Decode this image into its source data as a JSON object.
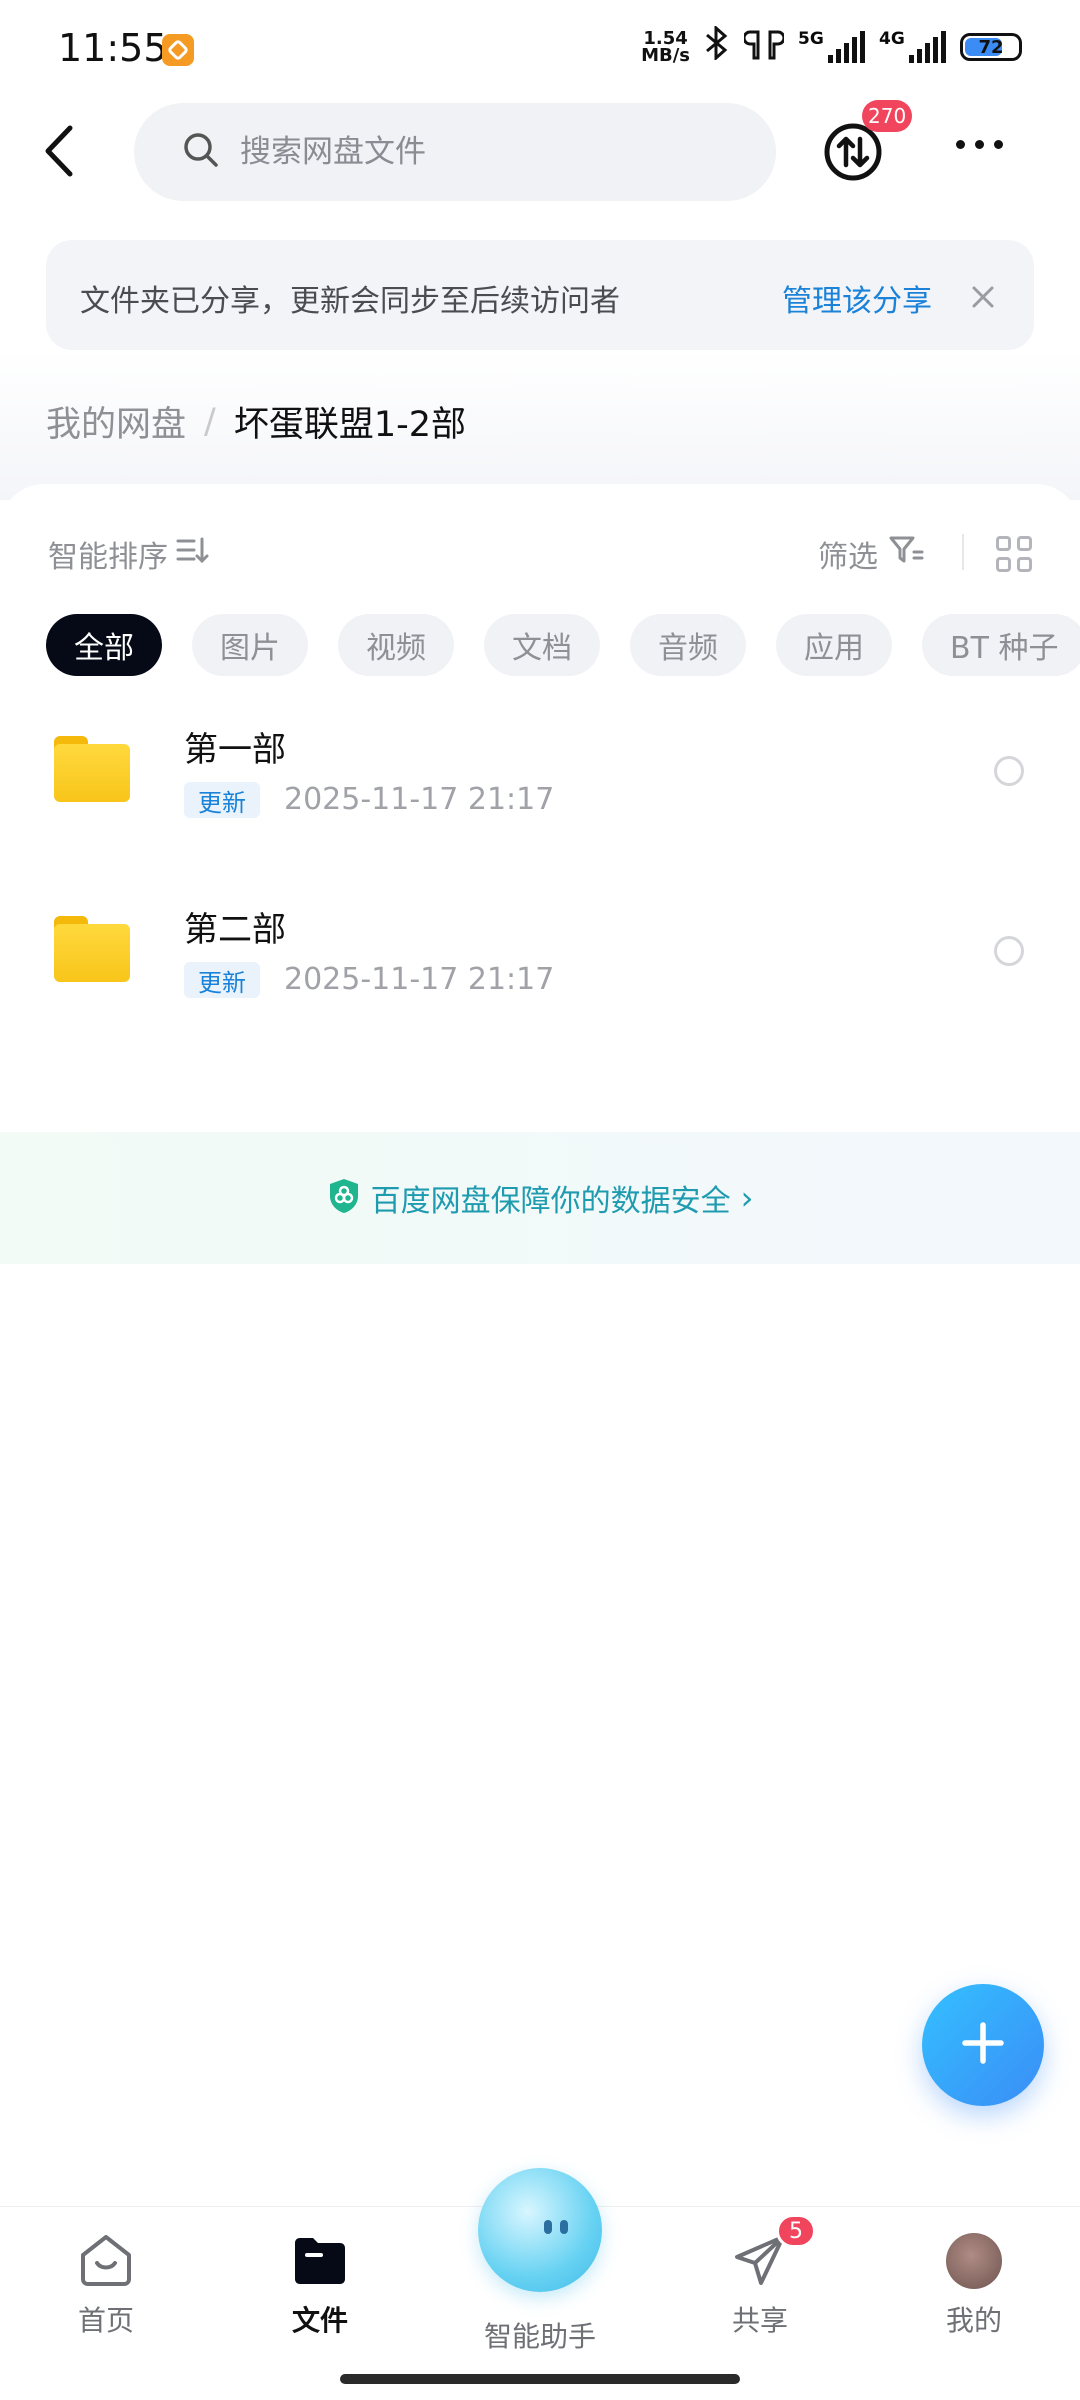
{
  "status_bar": {
    "time": "11:55",
    "net_speed_value": "1.54",
    "net_speed_unit": "MB/s",
    "signal_1_label": "5G",
    "signal_2_label": "4G",
    "battery": "72",
    "battery_level": 0.72
  },
  "top_bar": {
    "search_placeholder": "搜索网盘文件",
    "transfer_badge": "270",
    "icons": [
      "back-arrow-icon",
      "search-icon",
      "transfer-icon",
      "more-icon"
    ]
  },
  "share_notice": {
    "text": "文件夹已分享，更新会同步至后续访问者",
    "action": "管理该分享",
    "close": "×"
  },
  "breadcrumb": {
    "root": "我的网盘",
    "separator": "/",
    "current": "坏蛋联盟1-2部"
  },
  "toolbar": {
    "sort_label": "智能排序",
    "filter_label": "筛选"
  },
  "chips": [
    "全部",
    "图片",
    "视频",
    "文档",
    "音频",
    "应用",
    "BT 种子"
  ],
  "files": [
    {
      "name": "第一部",
      "tag": "更新",
      "date": "2025-11-17  21:17"
    },
    {
      "name": "第二部",
      "tag": "更新",
      "date": "2025-11-17  21:17"
    }
  ],
  "safety_banner": {
    "text": "百度网盘保障你的数据安全",
    "arrow": "›"
  },
  "bottom_nav": {
    "items": [
      {
        "label": "首页"
      },
      {
        "label": "文件"
      },
      {
        "label": "智能助手"
      },
      {
        "label": "共享",
        "badge": "5"
      },
      {
        "label": "我的"
      }
    ]
  },
  "colors": {
    "accent": "#1a82d8",
    "badge": "#f0455c",
    "chip_active": "#060a17",
    "fab": "#3a8df6"
  }
}
